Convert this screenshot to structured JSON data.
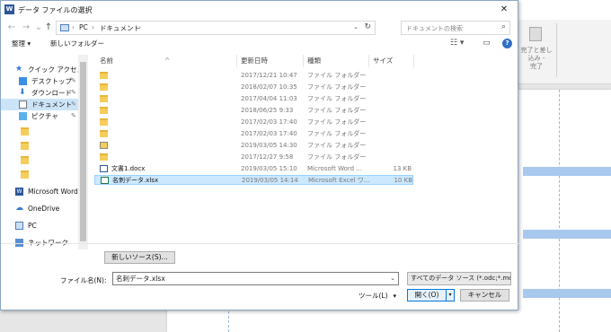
{
  "dialog": {
    "title": "データ ファイルの選択",
    "title_icon": "W",
    "close": "✕"
  },
  "nav": {
    "back": "←",
    "forward": "→",
    "recent": "⌄",
    "up": "↑",
    "breadcrumb": [
      "PC",
      "ドキュメント"
    ],
    "crumb_sep": "›",
    "search_placeholder": "ドキュメントの検索"
  },
  "toolbar": {
    "organize": "整理 ▾",
    "new_folder": "新しいフォルダー"
  },
  "sidebar": {
    "items": [
      {
        "label": "クイック アクセス",
        "icon": "star-icon"
      },
      {
        "label": "デスクトップ",
        "icon": "desktop-icon",
        "pinned": true
      },
      {
        "label": "ダウンロード",
        "icon": "download-icon",
        "pinned": true
      },
      {
        "label": "ドキュメント",
        "icon": "documents-icon",
        "pinned": true,
        "selected": true
      },
      {
        "label": "ピクチャ",
        "icon": "pictures-icon",
        "pinned": true
      },
      {
        "label": "",
        "icon": "folder-icon"
      },
      {
        "label": "",
        "icon": "folder-icon"
      },
      {
        "label": "",
        "icon": "folder-icon"
      },
      {
        "label": "",
        "icon": "folder-icon"
      },
      {
        "label": "Microsoft Word",
        "icon": "word-icon"
      },
      {
        "label": "OneDrive",
        "icon": "onedrive-icon"
      },
      {
        "label": "PC",
        "icon": "pc-icon"
      },
      {
        "label": "ネットワーク",
        "icon": "network-icon"
      }
    ]
  },
  "columns": {
    "name": "名前",
    "date": "更新日時",
    "type": "種類",
    "size": "サイズ"
  },
  "files": [
    {
      "name": "",
      "date": "2017/12/21 10:47",
      "type": "ファイル フォルダー",
      "size": "",
      "icon": "folder"
    },
    {
      "name": "",
      "date": "2018/02/07 10:35",
      "type": "ファイル フォルダー",
      "size": "",
      "icon": "folder"
    },
    {
      "name": "",
      "date": "2017/04/04 11:03",
      "type": "ファイル フォルダー",
      "size": "",
      "icon": "folder"
    },
    {
      "name": "",
      "date": "2018/06/25 9:33",
      "type": "ファイル フォルダー",
      "size": "",
      "icon": "folder"
    },
    {
      "name": "",
      "date": "2017/02/03 17:40",
      "type": "ファイル フォルダー",
      "size": "",
      "icon": "folder"
    },
    {
      "name": "",
      "date": "2017/02/03 17:40",
      "type": "ファイル フォルダー",
      "size": "",
      "icon": "folder"
    },
    {
      "name": "",
      "date": "2019/03/05 14:30",
      "type": "ファイル フォルダー",
      "size": "",
      "icon": "template"
    },
    {
      "name": "",
      "date": "2017/12/27 9:58",
      "type": "ファイル フォルダー",
      "size": "",
      "icon": "folder"
    },
    {
      "name": "文書1.docx",
      "date": "2019/03/05 15:10",
      "type": "Microsoft Word ...",
      "size": "13 KB",
      "icon": "word"
    },
    {
      "name": "名刺データ.xlsx",
      "date": "2019/03/05 14:14",
      "type": "Microsoft Excel ワ...",
      "size": "10 KB",
      "icon": "excel",
      "selected": true
    }
  ],
  "bottom": {
    "new_source": "新しいソース(S)...",
    "filename_label": "ファイル名(N):",
    "filename_value": "名刺データ.xlsx",
    "filetype_value": "すべてのデータ ソース (*.odc;*.mdb",
    "tools": "ツール(L)",
    "open": "開く(O)",
    "cancel": "キャンセル"
  },
  "background": {
    "ribbon_label": "完了と差し込み -",
    "ribbon_group": "完了"
  },
  "colors": {
    "selection": "#cce8ff",
    "accent": "#0078d7",
    "folder": "#f5cd5a",
    "word": "#2b579a",
    "excel": "#217346"
  }
}
